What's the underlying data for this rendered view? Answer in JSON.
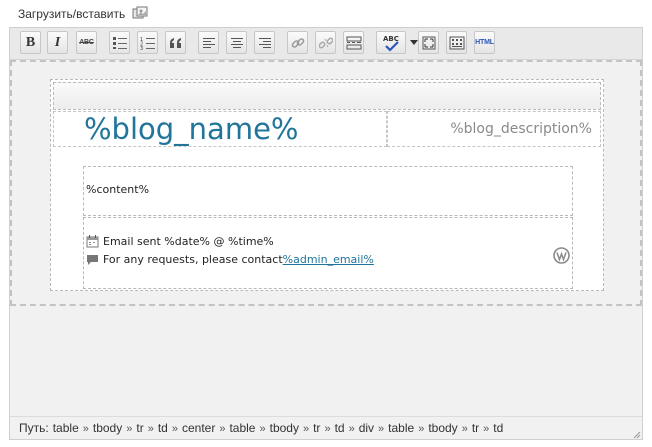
{
  "media": {
    "upload_label": "Загрузить/вставить",
    "icon": "add-media-icon"
  },
  "toolbar": {
    "buttons": [
      {
        "name": "bold",
        "label": "B"
      },
      {
        "name": "italic",
        "label": "I"
      },
      {
        "name": "strikethrough",
        "label": "ABC"
      },
      {
        "name": "bullet-list",
        "icon": "unordered-list-icon"
      },
      {
        "name": "numbered-list",
        "icon": "ordered-list-icon"
      },
      {
        "name": "blockquote",
        "icon": "quote-icon"
      },
      {
        "name": "align-left",
        "icon": "align-left-icon"
      },
      {
        "name": "align-center",
        "icon": "align-center-icon"
      },
      {
        "name": "align-right",
        "icon": "align-right-icon"
      },
      {
        "name": "insert-link",
        "icon": "link-icon"
      },
      {
        "name": "unlink",
        "icon": "unlink-icon"
      },
      {
        "name": "insert-more",
        "icon": "more-tag-icon"
      },
      {
        "name": "spellcheck",
        "label": "ABC"
      },
      {
        "name": "fullscreen",
        "icon": "fullscreen-icon"
      },
      {
        "name": "kitchen-sink",
        "icon": "kitchen-sink-icon"
      },
      {
        "name": "edit-html",
        "label": "HTML"
      }
    ]
  },
  "template": {
    "blog_name": "%blog_name%",
    "blog_description": "%blog_description%",
    "content": "%content%",
    "footer_sent": "Email sent %date% @ %time%",
    "footer_requests_prefix": "For any requests, please contact ",
    "footer_admin_email": "%admin_email%",
    "accent_color": "#21759b"
  },
  "status": {
    "path_label": "Путь:",
    "path": [
      "table",
      "tbody",
      "tr",
      "td",
      "center",
      "table",
      "tbody",
      "tr",
      "td",
      "div",
      "table",
      "tbody",
      "tr",
      "td"
    ]
  }
}
